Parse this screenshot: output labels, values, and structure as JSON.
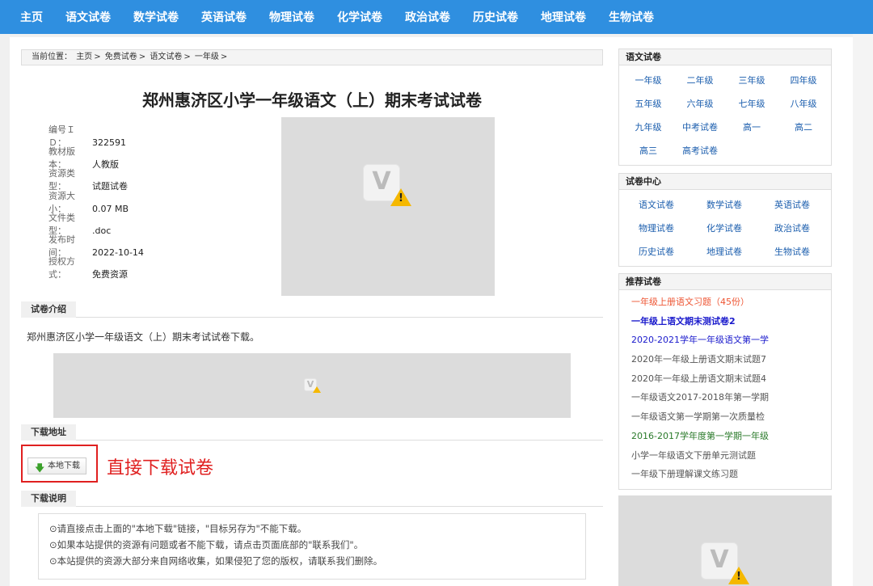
{
  "nav": [
    "主页",
    "语文试卷",
    "数学试卷",
    "英语试卷",
    "物理试卷",
    "化学试卷",
    "政治试卷",
    "历史试卷",
    "地理试卷",
    "生物试卷"
  ],
  "breadcrumb": {
    "label": "当前位置：",
    "items": [
      "主页",
      "免费试卷",
      "语文试卷",
      "一年级"
    ],
    "sep": ">"
  },
  "title": "郑州惠济区小学一年级语文（上）期末考试试卷",
  "meta": [
    {
      "label": "编号ＩＤ：",
      "value": "322591"
    },
    {
      "label": "教材版本：",
      "value": "人教版"
    },
    {
      "label": "资源类型：",
      "value": "试题试卷"
    },
    {
      "label": "资源大小：",
      "value": "0.07 MB"
    },
    {
      "label": "文件类型：",
      "value": ".doc"
    },
    {
      "label": "发布时间：",
      "value": "2022-10-14"
    },
    {
      "label": "授权方式：",
      "value": "免费资源"
    }
  ],
  "sections": {
    "intro_head": "试卷介绍",
    "intro_text": "郑州惠济区小学一年级语文（上）期末考试试卷下载。",
    "download_head": "下载地址",
    "download_button": "本地下载",
    "annotation": "直接下载试卷",
    "notes_head": "下载说明",
    "notes": [
      "⊙请直接点击上面的\"本地下载\"链接，\"目标另存为\"不能下载。",
      "⊙如果本站提供的资源有问题或者不能下载，请点击页面底部的\"联系我们\"。",
      "⊙本站提供的资源大部分来自网络收集，如果侵犯了您的版权，请联系我们删除。"
    ]
  },
  "sidebar": {
    "chinese": {
      "head": "语文试卷",
      "items": [
        "一年级",
        "二年级",
        "三年级",
        "四年级",
        "五年级",
        "六年级",
        "七年级",
        "八年级",
        "九年级",
        "中考试卷",
        "高一",
        "高二",
        "高三",
        "高考试卷"
      ]
    },
    "center": {
      "head": "试卷中心",
      "items": [
        "语文试卷",
        "数学试卷",
        "英语试卷",
        "物理试卷",
        "化学试卷",
        "政治试卷",
        "历史试卷",
        "地理试卷",
        "生物试卷"
      ]
    },
    "recommend": {
      "head": "推荐试卷",
      "items": [
        {
          "text": "一年级上册语文习题（45份）",
          "color": "#ee5533"
        },
        {
          "text": "一年级上语文期末测试卷2",
          "color": "#1a1acc"
        },
        {
          "text": "2020-2021学年一年级语文第一学",
          "color": "#1a1acc"
        },
        {
          "text": "2020年一年级上册语文期末试题7",
          "color": "#555555"
        },
        {
          "text": "2020年一年级上册语文期末试题4",
          "color": "#555555"
        },
        {
          "text": "一年级语文2017-2018年第一学期",
          "color": "#555555"
        },
        {
          "text": "一年级语文第一学期第一次质量检",
          "color": "#555555"
        },
        {
          "text": "2016-2017学年度第一学期一年级",
          "color": "#2a7a2a"
        },
        {
          "text": "小学一年级语文下册单元测试题",
          "color": "#555555"
        },
        {
          "text": "一年级下册理解课文练习题",
          "color": "#555555"
        }
      ]
    }
  },
  "colors": {
    "nav_bg": "#2f8fe0",
    "link": "#1a5dad",
    "annotation_red": "#e02020"
  }
}
